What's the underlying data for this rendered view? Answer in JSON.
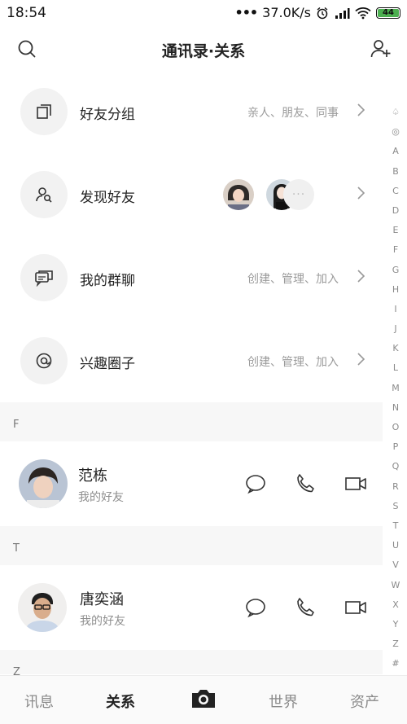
{
  "status_bar": {
    "time": "18:54",
    "dots": "•••",
    "network_speed": "37.0K/s",
    "battery": "44"
  },
  "header": {
    "title": "通讯录·关系",
    "search_icon": "search-icon",
    "add_icon": "add-friend-icon"
  },
  "features": [
    {
      "label": "好友分组",
      "sub": "亲人、朋友、同事",
      "icon": "group-icon"
    },
    {
      "label": "发现好友",
      "sub": "",
      "icon": "discover-friends-icon",
      "more": "···"
    },
    {
      "label": "我的群聊",
      "sub": "创建、管理、加入",
      "icon": "group-chat-icon"
    },
    {
      "label": "兴趣圈子",
      "sub": "创建、管理、加入",
      "icon": "interest-circle-icon"
    }
  ],
  "sections": [
    {
      "letter": "F",
      "contacts": [
        {
          "name": "范栋",
          "relation": "我的好友"
        }
      ]
    },
    {
      "letter": "T",
      "contacts": [
        {
          "name": "唐奕涵",
          "relation": "我的好友"
        }
      ]
    }
  ],
  "peek_letter": "Z",
  "alphabet": [
    "♤",
    "◎",
    "A",
    "B",
    "C",
    "D",
    "E",
    "F",
    "G",
    "H",
    "I",
    "J",
    "K",
    "L",
    "M",
    "N",
    "O",
    "P",
    "Q",
    "R",
    "S",
    "T",
    "U",
    "V",
    "W",
    "X",
    "Y",
    "Z",
    "#"
  ],
  "bottom_nav": {
    "items": [
      "讯息",
      "关系",
      "世界",
      "资产"
    ],
    "active": "关系",
    "camera_icon": "camera-icon"
  },
  "colors": {
    "battery_fill": "#4caf50",
    "section_bg": "#f7f7f7",
    "muted_text": "#9b9b9b"
  }
}
